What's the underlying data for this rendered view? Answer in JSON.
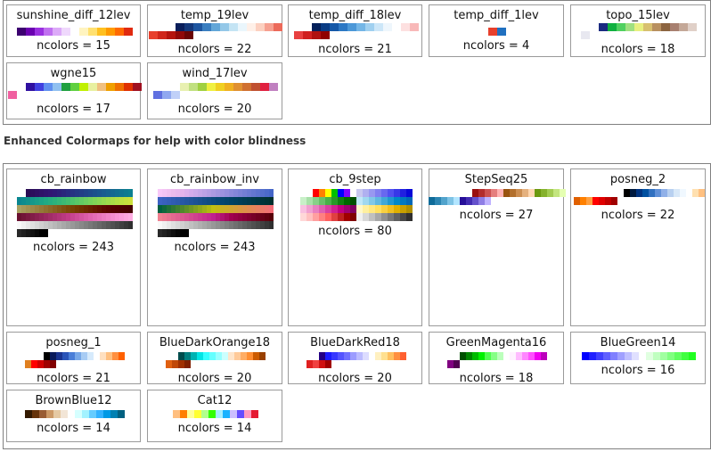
{
  "section_heading": "Enhanced Colormaps for help with color blindness",
  "ncolors_prefix": "ncolors = ",
  "top_cards": [
    {
      "name": "sunshine_diff_12lev",
      "ncolors": 15,
      "rows": [
        [
          "#3c0070",
          "#6a00b0",
          "#9a30e0",
          "#c070f0",
          "#dcaaf8",
          "#efd8fc",
          "#ffffff",
          "#fff4c0",
          "#ffe070",
          "#ffc020",
          "#ff9a00",
          "#ff6a00",
          "#e02a10"
        ]
      ]
    },
    {
      "name": "temp_19lev",
      "ncolors": 22,
      "rows": [
        [
          "",
          "",
          "",
          "#0a1e5a",
          "#14387a",
          "#1e56a0",
          "#3a7ec0",
          "#62a6d8",
          "#94c8e8",
          "#c4e4f4",
          "#eaf6fc",
          "#fff0e8",
          "#fcd0c0",
          "#f6a090",
          "#ec6a5a"
        ],
        [
          "#e8402c",
          "#d0261a",
          "#b4140e",
          "#900808",
          "#6a0404"
        ]
      ]
    },
    {
      "name": "temp_diff_18lev",
      "ncolors": 21,
      "rows": [
        [
          "",
          "",
          "#04205a",
          "#0a3c84",
          "#1458a8",
          "#2c78c4",
          "#4c98d8",
          "#74b6e6",
          "#a0d0f0",
          "#cce6f8",
          "#eef6fc",
          "#ffffff",
          "#fde0e0",
          "#f8b8b8"
        ],
        [
          "#e84040",
          "#d02020",
          "#b01010",
          "#900000"
        ]
      ]
    },
    {
      "name": "temp_diff_1lev",
      "ncolors": 4,
      "rows": [
        [
          "#e8402c",
          "#2070c0"
        ]
      ]
    },
    {
      "name": "topo_15lev",
      "ncolors": 18,
      "rows": [
        [
          "",
          "",
          "#1a2a80",
          "#10b040",
          "#50d060",
          "#a0e080",
          "#e8f080",
          "#d8c070",
          "#b89060",
          "#8c6440",
          "#a88070",
          "#c4a898",
          "#e0d0c8"
        ],
        [
          "#e8e8f0"
        ]
      ]
    },
    {
      "name": "wgne15",
      "ncolors": 17,
      "rows": [
        [
          "",
          "",
          "#3010a0",
          "#4040e0",
          "#6090f0",
          "#90c0f0",
          "#20a040",
          "#60d040",
          "#c0f000",
          "#e8f0a0",
          "#f0c080",
          "#f0a000",
          "#f07000",
          "#e03000",
          "#a01020"
        ],
        [
          "#f060a0"
        ]
      ]
    },
    {
      "name": "wind_17lev",
      "ncolors": 20,
      "rows": [
        [
          "",
          "",
          "",
          "#e8f0b0",
          "#c0e080",
          "#a0d040",
          "#f0f040",
          "#f0d020",
          "#f0b020",
          "#e09030",
          "#d07030",
          "#c05030",
          "#e02040",
          "#c080c0"
        ],
        [
          "#6070e0",
          "#90a8f0",
          "#c0d0f8"
        ]
      ]
    }
  ],
  "cb_cards": [
    {
      "name": "cb_rainbow",
      "ncolors": 243,
      "rows": [
        [
          "",
          "",
          "#2a0c54",
          "#2c0e5c",
          "#2e1062",
          "#2f1268",
          "#30146e",
          "#311672",
          "#2e1a76",
          "#2c2078",
          "#2a267c",
          "#282c80",
          "#263282",
          "#243884",
          "#223e86",
          "#204488",
          "#1e4a8a",
          "#1c508c",
          "#1a568e",
          "#185c90",
          "#166290",
          "#146890",
          "#126e90",
          "#107490",
          "#0e7a90",
          "#0c8090"
        ],
        [
          "#0a8690",
          "#0c8c8e",
          "#10928c",
          "#14988a",
          "#189e88",
          "#1ca486",
          "#20aa84",
          "#26ae80",
          "#2cb27c",
          "#34b678",
          "#3cba74",
          "#44be70",
          "#4ec26c",
          "#58c668",
          "#62ca64",
          "#6cce60",
          "#76d25c",
          "#80d458",
          "#8ad654",
          "#94d850",
          "#9eda4c",
          "#a8dc48",
          "#b2de44",
          "#bce040",
          "#c4e03e",
          "#cce03c"
        ],
        [
          "#a8a060",
          "#a49858",
          "#a09050",
          "#9c8848",
          "#988040",
          "#947838",
          "#907030",
          "#8c6828",
          "#886020",
          "#845818",
          "#805010",
          "#7c4808",
          "#784004",
          "#743800",
          "#703000",
          "#6c2800",
          "#682000",
          "#641800",
          "#601000",
          "#5c0800",
          "#580400",
          "#540000",
          "#500000",
          "#4c0000",
          "#480000",
          "#440000"
        ],
        [
          "#6a1030",
          "#721438",
          "#7a1840",
          "#821c48",
          "#8a2050",
          "#922458",
          "#9a2860",
          "#a22c68",
          "#aa3070",
          "#b23478",
          "#ba3880",
          "#c23c88",
          "#c84490",
          "#ce4c98",
          "#d454a0",
          "#da5ca8",
          "#e064b0",
          "#e46cb6",
          "#e874bc",
          "#ec7cc2",
          "#f084c8",
          "#f48cce",
          "#f894d4",
          "#fc9cda",
          "#fea4de",
          "#fface2"
        ],
        [
          "#f8f8f8",
          "#f0f0f0",
          "#e8e8e8",
          "#e0e0e0",
          "#d8d8d8",
          "#d0d0d0",
          "#c8c8c8",
          "#c0c0c0",
          "#b8b8b8",
          "#b0b0b0",
          "#a8a8a8",
          "#a0a0a0",
          "#989898",
          "#909090",
          "#888888",
          "#808080",
          "#787878",
          "#707070",
          "#686868",
          "#606060",
          "#585858",
          "#505050",
          "#484848",
          "#404040",
          "#383838",
          "#303030"
        ],
        [
          "#282828",
          "#202020",
          "#181818",
          "#101010",
          "#080808",
          "#000000",
          "#000000"
        ]
      ]
    },
    {
      "name": "cb_rainbow_inv",
      "ncolors": 243,
      "rows": [
        [
          "#f8c8f8",
          "#f4c4f4",
          "#f0c0f0",
          "#ecbcec",
          "#e8b8ec",
          "#e4b4ec",
          "#dcb0ec",
          "#d4acec",
          "#ccaaea",
          "#c4a6e8",
          "#bca2e6",
          "#b49ee4",
          "#ac9ae2",
          "#a496e0",
          "#9c92de",
          "#948edc",
          "#8c8ada",
          "#8486d8",
          "#7c82d6",
          "#747ed4",
          "#6c7ad2",
          "#6476d0",
          "#5c72ce",
          "#546ecc",
          "#4c6aca",
          "#4466c8"
        ],
        [
          "#3c62c4",
          "#3860be",
          "#345eb8",
          "#305cb2",
          "#2c5aac",
          "#2858a6",
          "#2456a0",
          "#20549a",
          "#1c5294",
          "#18508e",
          "#144e88",
          "#104c82",
          "#0c4a7c",
          "#084876",
          "#044670",
          "#02446a",
          "#004264",
          "#00405e",
          "#003e58",
          "#003c52",
          "#003a4c",
          "#003846",
          "#003640",
          "#00343a",
          "#003234",
          "#00302e"
        ],
        [
          "#006040",
          "#10683c",
          "#207038",
          "#307834",
          "#408030",
          "#50882c",
          "#609028",
          "#709824",
          "#80a020",
          "#90a81c",
          "#a0b018",
          "#b0b814",
          "#c0c010",
          "#c4b818",
          "#c8b020",
          "#ccaa28",
          "#d0a430",
          "#d49e38",
          "#d89840",
          "#dc9248",
          "#e08c50",
          "#e48658",
          "#e88060",
          "#ec7a68",
          "#f07470",
          "#f46e78"
        ],
        [
          "#f08090",
          "#ec7890",
          "#e87090",
          "#e46890",
          "#e06090",
          "#dc5890",
          "#d85090",
          "#d44890",
          "#d04090",
          "#cc3890",
          "#c83090",
          "#c42890",
          "#c02090",
          "#b81880",
          "#b01070",
          "#a80860",
          "#a00050",
          "#980048",
          "#900040",
          "#880038",
          "#800030",
          "#780028",
          "#700020",
          "#680018",
          "#600010",
          "#580008"
        ],
        [
          "#f8f8f8",
          "#f0f0f0",
          "#e8e8e8",
          "#e0e0e0",
          "#d8d8d8",
          "#d0d0d0",
          "#c8c8c8",
          "#c0c0c0",
          "#b8b8b8",
          "#b0b0b0",
          "#a8a8a8",
          "#a0a0a0",
          "#989898",
          "#909090",
          "#888888",
          "#808080",
          "#787878",
          "#707070",
          "#686868",
          "#606060",
          "#585858",
          "#505050",
          "#484848",
          "#404040",
          "#383838",
          "#303030"
        ],
        [
          "#282828",
          "#202020",
          "#181818",
          "#101010",
          "#080808",
          "#000000",
          "#000000"
        ]
      ]
    },
    {
      "name": "cb_9step",
      "ncolors": 80,
      "rows": [
        [
          "",
          "",
          "#ff0000",
          "#ff8000",
          "#ffff00",
          "#00c000",
          "#0000ff",
          "#8000ff",
          "",
          "#c8c8f0",
          "#b0b0f0",
          "#9898f0",
          "#8080f0",
          "#6868f0",
          "#5050f0",
          "#3838e8",
          "#2020e0",
          "#0808d8"
        ],
        [
          "#c8f0c8",
          "#a8e0a8",
          "#88d088",
          "#68c068",
          "#48b048",
          "#289828",
          "#108010",
          "#006800",
          "#005000",
          "#c0e8f8",
          "#a0d8f0",
          "#80c8e8",
          "#60b8e0",
          "#40a8d8",
          "#2098d0",
          "#0088c8",
          "#0078c0",
          "#0068b8"
        ],
        [
          "#f8c0e0",
          "#f0a0d0",
          "#e880c0",
          "#e060b0",
          "#d840a0",
          "#d02090",
          "#c00080",
          "#a00070",
          "#800060",
          "#fff8c8",
          "#fff0a0",
          "#ffe880",
          "#ffe060",
          "#f8d040",
          "#f0c020",
          "#e0b000",
          "#c8a000",
          "#b09000"
        ],
        [
          "#ffd8d8",
          "#ffc0c0",
          "#ffa0a0",
          "#ff8080",
          "#ff6060",
          "#e04040",
          "#c02020",
          "#a00000",
          "#800000",
          "#f0f0f0",
          "#d8d8d8",
          "#c0c0c0",
          "#a8a8a8",
          "#909090",
          "#787878",
          "#606060",
          "#484848",
          "#303030"
        ]
      ]
    },
    {
      "name": "StepSeq25",
      "ncolors": 27,
      "rows": [
        [
          "",
          "",
          "",
          "",
          "",
          "",
          "",
          "#990f0f",
          "#b22c2c",
          "#cc5151",
          "#e57e7e",
          "#ffb2b2",
          "#99540f",
          "#b26f2c",
          "#cc8e51",
          "#e5b17e",
          "#ffd8b2",
          "#6b990f",
          "#85b22c",
          "#a3cc51",
          "#c3e57e",
          "#e5ffb2"
        ],
        [
          "#0f6b99",
          "#2c85b2",
          "#51a3cc",
          "#7ec3e5",
          "#b2e5ff",
          "#260f99",
          "#422cb2",
          "#6551cc",
          "#8f7ee5",
          "#bfb2ff"
        ]
      ]
    },
    {
      "name": "posneg_2",
      "ncolors": 22,
      "rows": [
        [
          "",
          "",
          "",
          "",
          "",
          "",
          "",
          "",
          "#000000",
          "#001a40",
          "#003380",
          "#0050a0",
          "#3070c0",
          "#6090d8",
          "#90b0e8",
          "#b8d0f0",
          "#d8e8f8",
          "#f0f8ff",
          "#ffffff",
          "#ffe0b0",
          "#ffc080"
        ],
        [
          "#e06000",
          "#ff8000",
          "#ffa040",
          "#ff0000",
          "#e00000",
          "#c00000",
          "#a00000"
        ]
      ]
    },
    {
      "name": "posneg_1",
      "ncolors": 21,
      "rows": [
        [
          "",
          "",
          "",
          "#000000",
          "#0a1a5a",
          "#1a3490",
          "#2a54b8",
          "#4a7ed8",
          "#78a8e8",
          "#a8ccf4",
          "#d6eafc",
          "#ffffff",
          "#ffe0c0",
          "#ffc080",
          "#ff9040",
          "#ff6000"
        ],
        [
          "#e08020",
          "#ff0000",
          "#d00000",
          "#a00000",
          "#800000"
        ]
      ]
    },
    {
      "name": "BlueDarkOrange18",
      "ncolors": 20,
      "rows": [
        [
          "",
          "",
          "#004c4c",
          "#007f7f",
          "#00b2b2",
          "#00e5e5",
          "#32ffff",
          "#65ffff",
          "#99ffff",
          "#cbffff",
          "#ffe5cb",
          "#ffca99",
          "#ffad65",
          "#ff8e32",
          "#cc5b00",
          "#994000"
        ],
        [
          "#e06010",
          "#c04808",
          "#a03000",
          "#802000"
        ]
      ]
    },
    {
      "name": "BlueDarkRed18",
      "ncolors": 20,
      "rows": [
        [
          "",
          "",
          "#240082",
          "#1c1cff",
          "#3838ff",
          "#5454ff",
          "#7070ff",
          "#9c9cff",
          "#bcbcff",
          "#dcdcff",
          "#ffffff",
          "#fff0c0",
          "#ffe090",
          "#ffc060",
          "#ff9040",
          "#ff6030"
        ],
        [
          "#e02020",
          "#f04040",
          "#d01010",
          "#a00000"
        ]
      ]
    },
    {
      "name": "GreenMagenta16",
      "ncolors": 18,
      "rows": [
        [
          "",
          "",
          "#005000",
          "#008600",
          "#00bb00",
          "#00f100",
          "#50ff50",
          "#86ff86",
          "#bbffbb",
          "#ffffff",
          "#fff1ff",
          "#ffbbff",
          "#ff86ff",
          "#ff50ff",
          "#f100f1",
          "#bb00bb"
        ],
        [
          "#800080",
          "#500050"
        ]
      ]
    },
    {
      "name": "BlueGreen14",
      "ncolors": 16,
      "rows": [
        [
          "#0000ff",
          "#2020ff",
          "#4040ff",
          "#6060ff",
          "#8080ff",
          "#a0a0ff",
          "#c0c0ff",
          "#e0e0ff",
          "#ffffff",
          "#e0ffe0",
          "#c0ffc0",
          "#a0ffa0",
          "#80ff80",
          "#60ff60",
          "#40ff40",
          "#20ff20"
        ]
      ]
    },
    {
      "name": "BrownBlue12",
      "ncolors": 14,
      "rows": [
        [
          "#331900",
          "#66330a",
          "#995c33",
          "#cc9966",
          "#e5c9a3",
          "#f2e5d6",
          "#ffffff",
          "#d6ffff",
          "#a3f2ff",
          "#66ccff",
          "#33b2ff",
          "#0099e5",
          "#0080b2",
          "#006080"
        ]
      ]
    },
    {
      "name": "Cat12",
      "ncolors": 14,
      "rows": [
        [
          "#ffbf7f",
          "#ff7f00",
          "#ffff99",
          "#ffff32",
          "#b2ff8c",
          "#32ff00",
          "#a5edff",
          "#19b2ff",
          "#ccbfff",
          "#654cff",
          "#ff99bf",
          "#e51932"
        ]
      ]
    }
  ]
}
